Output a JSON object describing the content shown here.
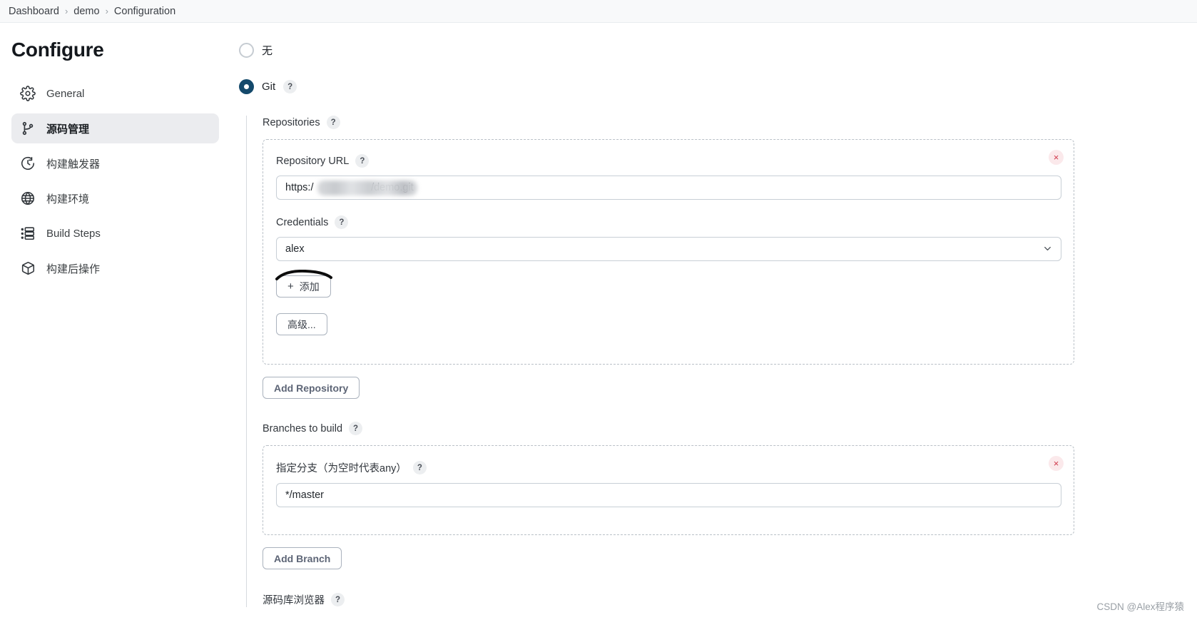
{
  "breadcrumb": {
    "items": [
      "Dashboard",
      "demo",
      "Configuration"
    ],
    "separator": "›"
  },
  "sidebar": {
    "title": "Configure",
    "items": [
      {
        "label": "General",
        "icon": "gear-icon",
        "active": false
      },
      {
        "label": "源码管理",
        "icon": "source-branch-icon",
        "active": true
      },
      {
        "label": "构建触发器",
        "icon": "clock-icon",
        "active": false
      },
      {
        "label": "构建环境",
        "icon": "globe-icon",
        "active": false
      },
      {
        "label": "Build Steps",
        "icon": "list-steps-icon",
        "active": false
      },
      {
        "label": "构建后操作",
        "icon": "package-icon",
        "active": false
      }
    ]
  },
  "scm": {
    "options": [
      {
        "label": "无",
        "selected": false,
        "has_help": false
      },
      {
        "label": "Git",
        "selected": true,
        "has_help": true
      }
    ],
    "repositories_label": "Repositories",
    "repository": {
      "url_label": "Repository URL",
      "url_value_prefix": "https:/",
      "url_value_suffix": "/demo.git",
      "url_value": "https:/                    /demo.git",
      "credentials_label": "Credentials",
      "credentials_value": "alex",
      "add_credentials_label": "添加",
      "add_credentials_plus": "+",
      "advanced_label": "高级...",
      "remove_label": "×"
    },
    "add_repository_label": "Add Repository",
    "branches_label": "Branches to build",
    "branch": {
      "spec_label": "指定分支（为空时代表any）",
      "spec_value": "*/master",
      "remove_label": "×"
    },
    "add_branch_label": "Add Branch",
    "repository_browser_label": "源码库浏览器",
    "help_badge": "?"
  },
  "watermark": "CSDN @Alex程序猿",
  "colors": {
    "accent": "#14496b",
    "remove_badge_bg": "#fbe9eb",
    "remove_badge_fg": "#d0384a",
    "sidebar_active_bg": "#ebecef",
    "button_text": "#5d6576"
  }
}
